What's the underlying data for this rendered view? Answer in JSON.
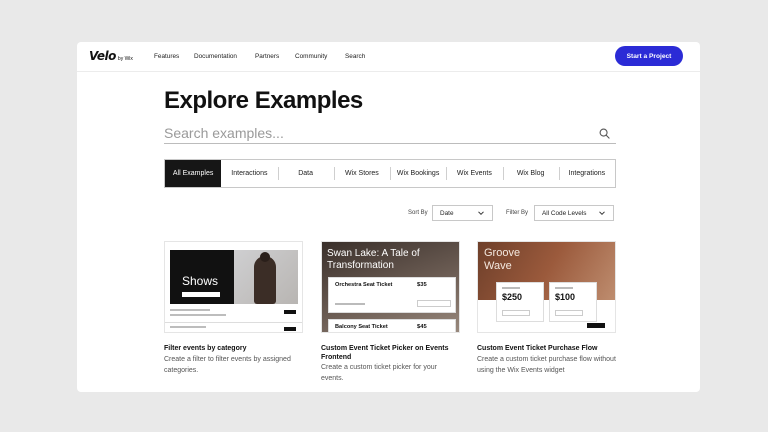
{
  "nav": {
    "logo_main": "Velo",
    "logo_sub": "by Wix",
    "links": [
      "Features",
      "Documentation",
      "Partners",
      "Community",
      "Search"
    ],
    "cta_label": "Start a Project"
  },
  "page_title": "Explore Examples",
  "search": {
    "placeholder": "Search examples...",
    "value": ""
  },
  "tabs": [
    "All Examples",
    "Interactions",
    "Data",
    "Wix Stores",
    "Wix Bookings",
    "Wix Events",
    "Wix Blog",
    "Integrations"
  ],
  "active_tab": "All Examples",
  "sort": {
    "label": "Sort By",
    "value": "Date"
  },
  "filter": {
    "label": "Filter By",
    "value": "All Code Levels"
  },
  "cards": [
    {
      "title": "Filter events by category",
      "description": "Create a filter to filter events by assigned categories.",
      "thumb_text": "Shows"
    },
    {
      "title": "Custom Event Ticket Picker on Events Frontend",
      "description": "Create a custom ticket picker for your events.",
      "thumb_title": "Swan Lake: A Tale of Transformation",
      "tickets": [
        {
          "name": "Orchestra Seat Ticket",
          "price": "$35"
        },
        {
          "name": "Balcony Seat Ticket",
          "price": "$45"
        }
      ]
    },
    {
      "title": "Custom Event Ticket Purchase Flow",
      "description": "Create a custom ticket purchase flow without using the Wix Events widget",
      "thumb_title": "Groove Wave",
      "prices": [
        "$250",
        "$100"
      ]
    }
  ],
  "colors": {
    "accent": "#2b2bd6",
    "active_tab": "#161616",
    "page_bg": "#e9e9e9"
  },
  "icons": [
    "search-icon",
    "chevron-down-icon"
  ]
}
